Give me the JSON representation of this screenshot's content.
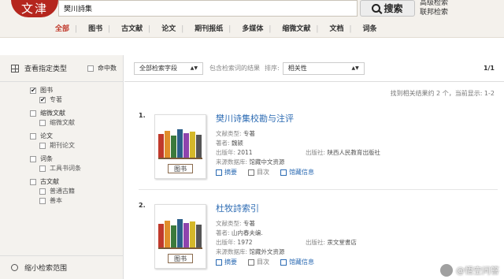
{
  "logo": {
    "text": "文津"
  },
  "search": {
    "value": "樊川詩集",
    "button_label": "搜索",
    "advanced": "高级检索",
    "federated": "联邦检索"
  },
  "tabs": [
    "全部",
    "图书",
    "古文献",
    "论文",
    "期刊报纸",
    "多媒体",
    "缩微文献",
    "文档",
    "词条"
  ],
  "sidebar": {
    "heading": "查看指定类型",
    "hit_label": "命中数",
    "categories": [
      {
        "label": "图书",
        "checked": true,
        "subs": [
          {
            "label": "专著",
            "checked": true
          }
        ]
      },
      {
        "label": "缩微文献",
        "checked": false,
        "subs": [
          {
            "label": "缩微文献",
            "checked": false
          }
        ]
      },
      {
        "label": "论文",
        "checked": false,
        "subs": [
          {
            "label": "期刊论文",
            "checked": false
          }
        ]
      },
      {
        "label": "词条",
        "checked": false,
        "subs": [
          {
            "label": "工具书词条",
            "checked": false
          }
        ]
      },
      {
        "label": "古文献",
        "checked": false,
        "subs": [
          {
            "label": "普通古籍",
            "checked": false
          },
          {
            "label": "善本",
            "checked": false
          }
        ]
      }
    ],
    "narrow": "缩小检索范围"
  },
  "filters": {
    "field_select": "全部检索字段",
    "contains": "包含检索词的结果",
    "sort_label": "排序:",
    "sort_select": "相关性",
    "page_indicator": "1/1"
  },
  "summary": "找到相关结果约 2 个，当前显示: 1-2",
  "results": [
    {
      "num": "1.",
      "title": "樊川诗集校勘与注评",
      "type_label": "文献类型:",
      "type": "专著",
      "author_label": "著者:",
      "author": "魏颍",
      "year_label": "出版年:",
      "year": "2011",
      "publisher_label": "出版社:",
      "publisher": "陕西人民教育出版社",
      "source_label": "来源数据库:",
      "source": "馆藏中文资源",
      "cover_label": "图书",
      "actions": [
        "摘要",
        "目次",
        "馆藏信息"
      ]
    },
    {
      "num": "2.",
      "title": "杜牧詩索引",
      "type_label": "文献类型:",
      "type": "专著",
      "author_label": "著者:",
      "author": "山内春夫编.",
      "year_label": "出版年:",
      "year": "1972",
      "publisher_label": "出版社:",
      "publisher": "汞文堂書店",
      "source_label": "来源数据库:",
      "source": "馆藏外文资源",
      "cover_label": "图书",
      "actions": [
        "摘要",
        "目次",
        "馆藏信息"
      ]
    }
  ],
  "watermark": "@悟空问答",
  "colors": {
    "brand_red": "#b5261e",
    "link_blue": "#2c6bb3",
    "tab_active": "#c0392b"
  }
}
